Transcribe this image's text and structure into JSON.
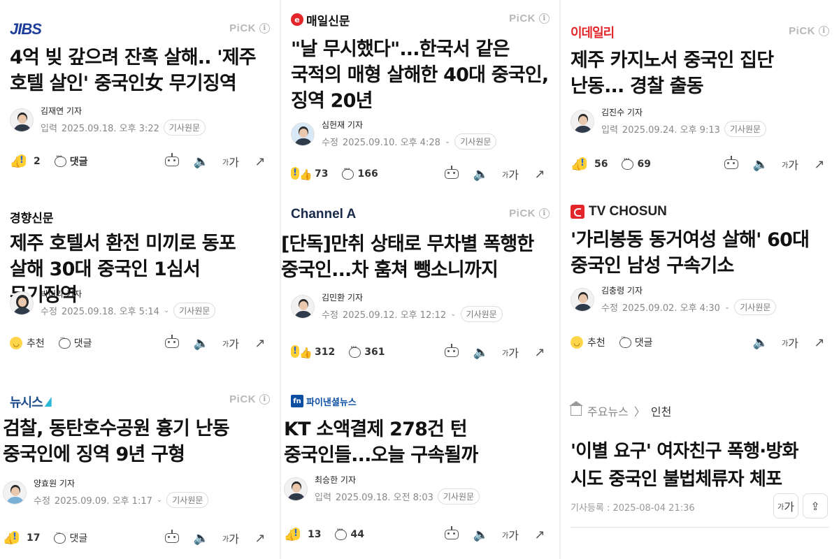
{
  "pick_label": "PiCK",
  "info_glyph": "i",
  "reactions_label": "추천",
  "comment_label": "댓글",
  "source_label": "기사원문",
  "font_size_label": "가",
  "cards": [
    {
      "outlet": "JIBS",
      "headline": "4억 빚 갚으려 잔혹 살해.. '제주 호텔 살인' 중국인女 무기징역",
      "reporter": "김재연 기자",
      "date_prefix": "입력",
      "date": "2025.09.18. 오후 3:22",
      "reactions": "2",
      "comments": "댓글"
    },
    {
      "outlet": "매일신문",
      "headline": "\"날 무시했다\"...한국서 같은 국적의 매형 살해한 40대 중국인, 징역 20년",
      "reporter": "심헌재 기자",
      "date_prefix": "수정",
      "date": "2025.09.10. 오후 4:28",
      "reactions": "73",
      "comments": "166"
    },
    {
      "outlet": "이데일리",
      "headline": "제주 카지노서 중국인 집단 난동... 경찰 출동",
      "reporter": "김진수 기자",
      "date_prefix": "입력",
      "date": "2025.09.24. 오후 9:13",
      "reactions": "56",
      "comments": "69"
    },
    {
      "outlet": "경향신문",
      "headline": "제주 호텔서 환전 미끼로 동포 살해 30대 중국인 1심서 무기징역",
      "reporter": "박미라 기자",
      "date_prefix": "수정",
      "date": "2025.09.18. 오후 5:14",
      "reactions": "추천",
      "comments": "댓글"
    },
    {
      "outlet": "Channel A",
      "headline": "[단독]만취 상태로 무차별 폭행한 중국인...차 훔쳐 뺑소니까지",
      "reporter": "김민환 기자",
      "date_prefix": "수정",
      "date": "2025.09.12. 오후 12:12",
      "reactions": "312",
      "comments": "361"
    },
    {
      "outlet": "TV CHOSUN",
      "headline": "'가리봉동 동거여성 살해' 60대 중국인 남성 구속기소",
      "reporter": "김충령 기자",
      "date_prefix": "수정",
      "date": "2025.09.02. 오후 4:30",
      "reactions": "추천",
      "comments": "댓글"
    },
    {
      "outlet": "뉴시스",
      "headline": "검찰, 동탄호수공원 흉기 난동 중국인에 징역 9년 구형",
      "reporter": "양효원 기자",
      "date_prefix": "수정",
      "date": "2025.09.09. 오후 1:17",
      "reactions": "17",
      "comments": "댓글"
    },
    {
      "outlet": "파이낸셜뉴스",
      "headline": "KT 소액결제 278건 턴 중국인들...오늘 구속될까",
      "reporter": "최승한 기자",
      "date_prefix": "입력",
      "date": "2025.09.18. 오전 8:03",
      "reactions": "13",
      "comments": "44"
    }
  ],
  "portal": {
    "crumb_home": "주요뉴스",
    "crumb_sep": "〉",
    "crumb_current": "인천",
    "headline": "'이별 요구' 여자친구 폭행·방화 시도 중국인 불법체류자 체포",
    "reg_date": "기사등록 : 2025-08-04 21:36"
  }
}
